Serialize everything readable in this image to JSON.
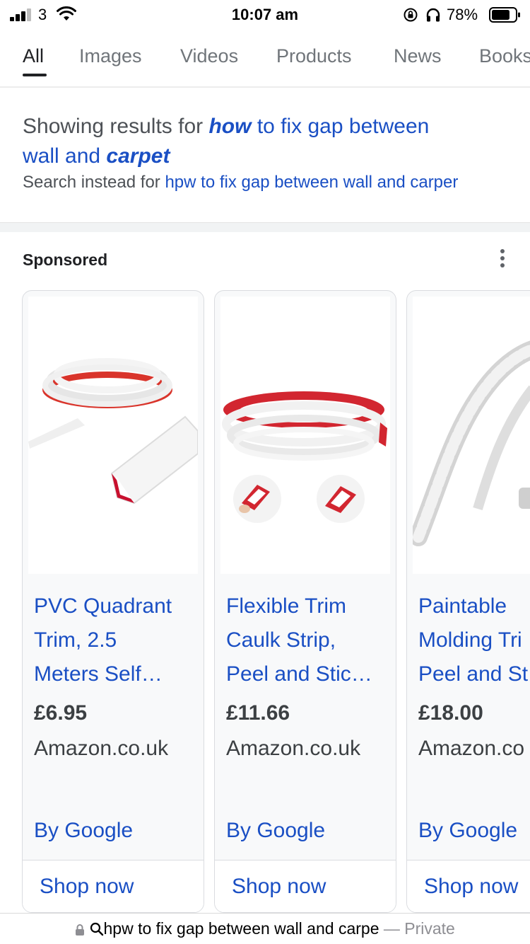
{
  "status_bar": {
    "carrier": "3",
    "time": "10:07 am",
    "battery_percent": "78%",
    "signal_bars_filled": 3,
    "battery_level": 0.78
  },
  "tabs": [
    {
      "label": "All",
      "active": true
    },
    {
      "label": "Images",
      "active": false
    },
    {
      "label": "Videos",
      "active": false
    },
    {
      "label": "Products",
      "active": false
    },
    {
      "label": "News",
      "active": false
    },
    {
      "label": "Books",
      "active": false
    }
  ],
  "correction": {
    "prefix": "Showing results for",
    "how": "how",
    "middle": "to fix gap between",
    "wall_and": "wall and",
    "carpet": "carpet",
    "instead_prefix": "Search instead for",
    "instead_query": "hpw to fix gap between wall and carper"
  },
  "sponsored": {
    "label": "Sponsored",
    "more_icon": "more-vert-icon"
  },
  "products": [
    {
      "title_lines": [
        "PVC Quadrant",
        "Trim, 2.5",
        "Meters Self…"
      ],
      "price": "£6.95",
      "merchant": "Amazon.co.uk",
      "by": "By Google",
      "cta": "Shop now"
    },
    {
      "title_lines": [
        "Flexible Trim",
        "Caulk Strip,",
        "Peel and Stic…"
      ],
      "price": "£11.66",
      "merchant": "Amazon.co.uk",
      "by": "By Google",
      "cta": "Shop now"
    },
    {
      "title_lines": [
        "Paintable",
        "Molding Tri",
        "Peel and St"
      ],
      "price": "£18.00",
      "merchant": "Amazon.co",
      "by": "By Google",
      "cta": "Shop now"
    }
  ],
  "url_bar": {
    "query": "hpw to fix gap between wall and carpe",
    "mode": "— Private",
    "icons": [
      "lock-icon",
      "search-icon"
    ]
  },
  "colors": {
    "link_blue": "#1a4fc4",
    "card_bg": "#f8f9fa",
    "divider_bg": "#f1f3f4"
  }
}
